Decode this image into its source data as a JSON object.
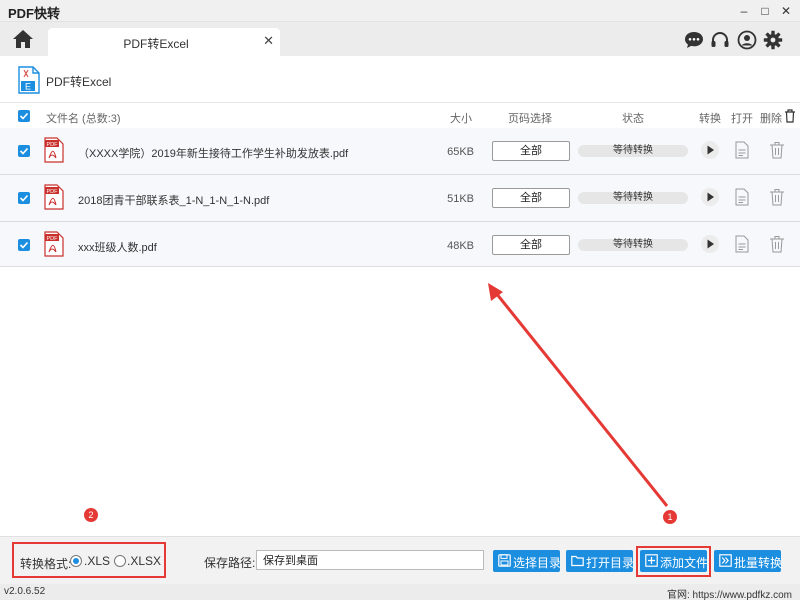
{
  "app": {
    "title": "PDF快转"
  },
  "window_controls": {
    "minimize": "–",
    "maximize": "□",
    "close": "✕"
  },
  "tab": {
    "label": "PDF转Excel",
    "close": "✕"
  },
  "page": {
    "title": "PDF转Excel",
    "icon_letter": "E"
  },
  "table": {
    "headers": {
      "name": "文件名 (总数:3)",
      "size": "大小",
      "pages": "页码选择",
      "status": "状态",
      "convert": "转换",
      "open": "打开",
      "delete": "删除"
    },
    "rows": [
      {
        "name": "（XXXX学院）2019年新生接待工作学生补助发放表.pdf",
        "size": "65KB",
        "pages": "全部",
        "status": "等待转换"
      },
      {
        "name": "2018团青干部联系表_1-N_1-N_1-N.pdf",
        "size": "51KB",
        "pages": "全部",
        "status": "等待转换"
      },
      {
        "name": "xxx班级人数.pdf",
        "size": "48KB",
        "pages": "全部",
        "status": "等待转换"
      }
    ]
  },
  "annotations": {
    "badge1": "1",
    "badge2": "2"
  },
  "bottom": {
    "format_label": "转换格式:",
    "format_options": [
      ".XLS",
      ".XLSX"
    ],
    "format_selected": ".XLS",
    "save_label": "保存路径:",
    "save_value": "保存到桌面",
    "btn_choose_dir": "选择目录",
    "btn_open_dir": "打开目录",
    "btn_add_file": "添加文件",
    "btn_batch": "批量转换"
  },
  "footer": {
    "version": "v2.0.6.52",
    "site": "官网: https://www.pdfkz.com"
  },
  "colors": {
    "accent": "#1c8ee0",
    "annotation": "#e53935",
    "row_bg": "#f6f8fb"
  },
  "icons": [
    "home-icon",
    "chat-icon",
    "headset-icon",
    "user-icon",
    "gear-icon",
    "pdf-file-icon",
    "play-icon",
    "document-icon",
    "trash-icon"
  ]
}
